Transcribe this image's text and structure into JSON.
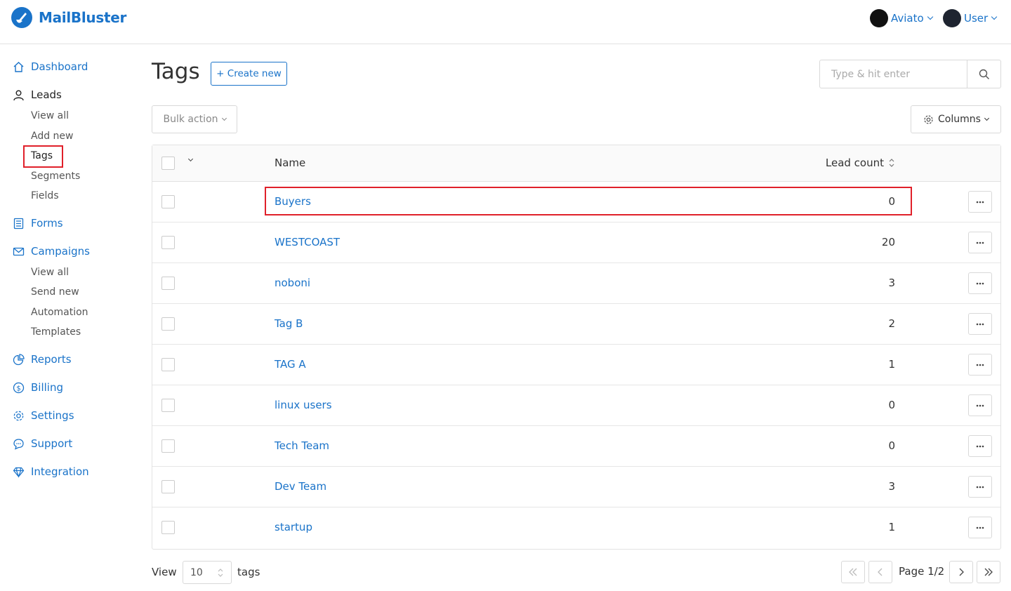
{
  "header": {
    "brand": "MailBluster",
    "workspace": "Aviato",
    "user": "User"
  },
  "sidebar": {
    "dashboard": "Dashboard",
    "leads": "Leads",
    "leads_sub": [
      "View all",
      "Add new",
      "Tags",
      "Segments",
      "Fields"
    ],
    "forms": "Forms",
    "campaigns": "Campaigns",
    "campaigns_sub": [
      "View all",
      "Send new",
      "Automation",
      "Templates"
    ],
    "reports": "Reports",
    "billing": "Billing",
    "settings": "Settings",
    "support": "Support",
    "integration": "Integration"
  },
  "main": {
    "title": "Tags",
    "create_label": "+ Create new",
    "search_placeholder": "Type & hit enter",
    "bulk_action": "Bulk action",
    "columns": "Columns",
    "table": {
      "headers": [
        "Name",
        "Lead count"
      ],
      "rows": [
        {
          "name": "Buyers",
          "count": "0"
        },
        {
          "name": "WESTCOAST",
          "count": "20"
        },
        {
          "name": "noboni",
          "count": "3"
        },
        {
          "name": "Tag B",
          "count": "2"
        },
        {
          "name": "TAG A",
          "count": "1"
        },
        {
          "name": "linux users",
          "count": "0"
        },
        {
          "name": "Tech Team",
          "count": "0"
        },
        {
          "name": "Dev Team",
          "count": "3"
        },
        {
          "name": "startup",
          "count": "1"
        }
      ]
    },
    "footer": {
      "view_label": "View",
      "per_page": "10",
      "suffix": "tags",
      "page_label": "Page 1/2"
    }
  },
  "colors": {
    "accent": "#1a73c9",
    "highlight": "#e0202a"
  }
}
